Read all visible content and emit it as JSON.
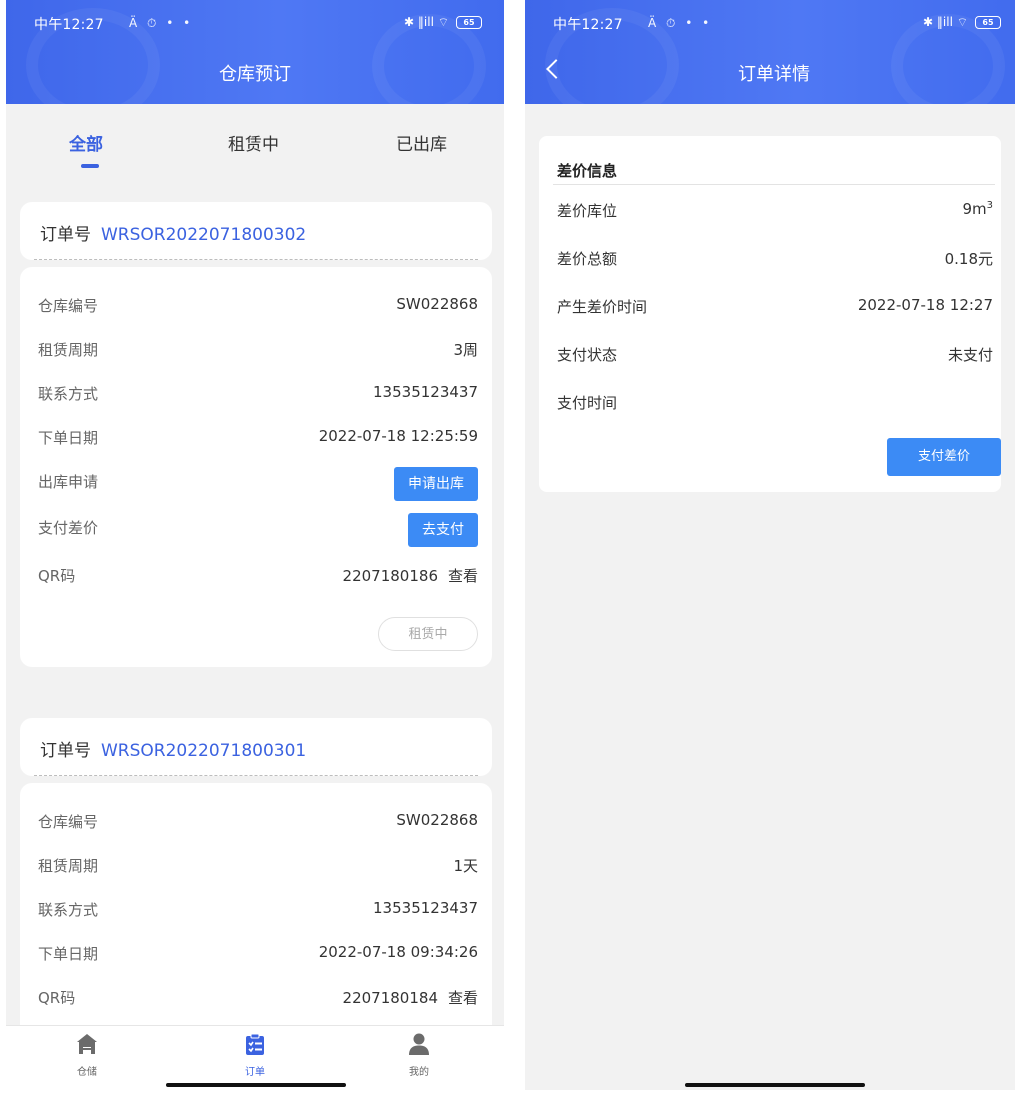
{
  "status_bar": {
    "time": "中午12:27",
    "icons": "Ä ⏱ • •",
    "signal": "✱ ‖ill ⌔",
    "battery": "65"
  },
  "left": {
    "title": "仓库预订",
    "tabs": [
      {
        "label": "全部",
        "active": true
      },
      {
        "label": "租赁中",
        "active": false
      },
      {
        "label": "已出库",
        "active": false
      }
    ],
    "orders": [
      {
        "order_label": "订单号",
        "order_no": "WRSOR2022071800302",
        "rows": {
          "warehouse_label": "仓库编号",
          "warehouse": "SW022868",
          "period_label": "租赁周期",
          "period": "3周",
          "contact_label": "联系方式",
          "contact": "13535123437",
          "date_label": "下单日期",
          "date": "2022-07-18 12:25:59",
          "outbound_label": "出库申请",
          "outbound_btn": "申请出库",
          "diff_label": "支付差价",
          "diff_btn": "去支付",
          "qr_label": "QR码",
          "qr": "2207180186",
          "qr_view": "查看"
        },
        "status": "租赁中"
      },
      {
        "order_label": "订单号",
        "order_no": "WRSOR2022071800301",
        "rows": {
          "warehouse_label": "仓库编号",
          "warehouse": "SW022868",
          "period_label": "租赁周期",
          "period": "1天",
          "contact_label": "联系方式",
          "contact": "13535123437",
          "date_label": "下单日期",
          "date": "2022-07-18 09:34:26",
          "qr_label": "QR码",
          "qr": "2207180184",
          "qr_view": "查看"
        }
      }
    ],
    "bottom_nav": [
      {
        "label": "仓储",
        "icon": "warehouse-icon"
      },
      {
        "label": "订单",
        "icon": "order-list-icon",
        "active": true
      },
      {
        "label": "我的",
        "icon": "profile-icon"
      }
    ]
  },
  "right": {
    "title": "订单详情",
    "section_title": "差价信息",
    "rows": {
      "slot_label": "差价库位",
      "slot_value": "9m",
      "slot_unit_sup": "3",
      "amount_label": "差价总额",
      "amount_value": "0.18元",
      "time_label": "产生差价时间",
      "time_value": "2022-07-18 12:27",
      "pay_status_label": "支付状态",
      "pay_status_value": "未支付",
      "pay_time_label": "支付时间",
      "pay_time_value": ""
    },
    "pay_button": "支付差价"
  },
  "colors": {
    "primary": "#3b62e0",
    "button": "#3c8bf5",
    "header_start": "#3f67ea",
    "header_end": "#4f78f4"
  }
}
